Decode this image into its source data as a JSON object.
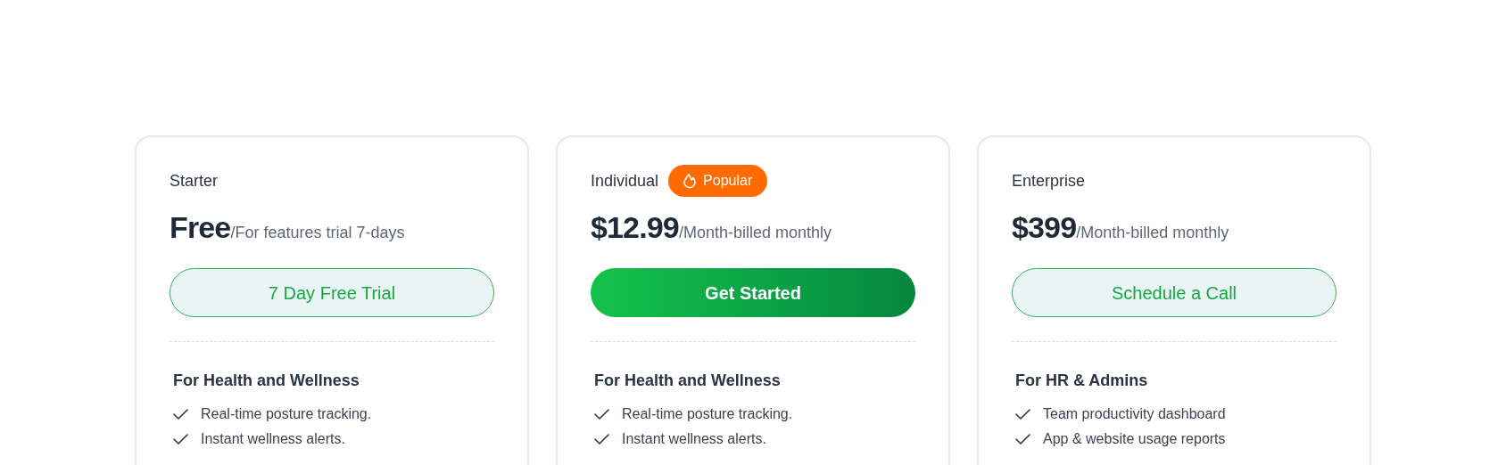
{
  "plans": [
    {
      "name": "Starter",
      "price": "Free",
      "period": "/For features trial 7-days",
      "button": {
        "label": "7 Day Free Trial",
        "kind": "outline"
      },
      "section_title": "For Health and Wellness",
      "features": [
        "Real-time posture tracking.",
        "Instant wellness alerts."
      ]
    },
    {
      "name": "Individual",
      "badge": "Popular",
      "price": "$12.99",
      "period": "/Month-billed monthly",
      "button": {
        "label": "Get Started",
        "kind": "filled"
      },
      "section_title": "For Health and Wellness",
      "features": [
        "Real-time posture tracking.",
        "Instant wellness alerts."
      ]
    },
    {
      "name": "Enterprise",
      "price": "$399",
      "period": "/Month-billed monthly",
      "button": {
        "label": "Schedule a Call",
        "kind": "outline"
      },
      "section_title": "For HR & Admins",
      "features": [
        "Team productivity dashboard",
        "App & website usage reports"
      ]
    }
  ]
}
